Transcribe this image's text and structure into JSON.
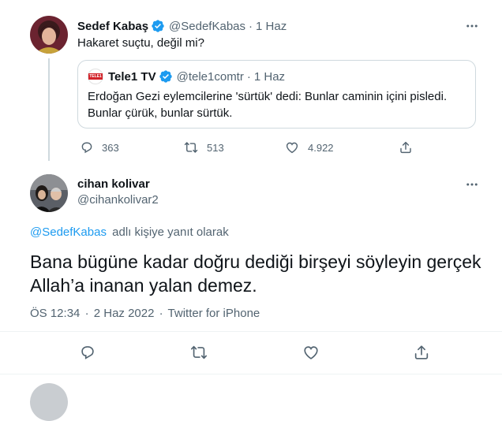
{
  "parent_tweet": {
    "author_name": "Sedef Kabaş",
    "author_handle": "@SedefKabas",
    "separator": "·",
    "time": "1 Haz",
    "text": "Hakaret suçtu, değil mi?",
    "quoted": {
      "logo_text": "TELE1",
      "author_name": "Tele1 TV",
      "author_handle": "@tele1comtr",
      "separator": "·",
      "time": "1 Haz",
      "text_line1": "Erdoğan Gezi eylemcilerine 'sürtük' dedi: Bunlar caminin içini pisledi.",
      "text_line2": "Bunlar çürük, bunlar sürtük."
    },
    "actions": {
      "replies": "363",
      "retweets": "513",
      "likes": "4.922"
    }
  },
  "main_tweet": {
    "author_name": "cihan kolivar",
    "author_handle": "@cihankolivar2",
    "reply_to_user": "@SedefKabas",
    "reply_to_suffix": "adlı kişiye yanıt olarak",
    "text_line1": "Bana bügüne kadar doğru dediği birşeyi söyleyin gerçek",
    "text_line2": "Allah’a inanan yalan demez.",
    "time": "ÖS 12:34",
    "separator1": "·",
    "date": "2 Haz 2022",
    "separator2": "·",
    "source": "Twitter for iPhone"
  },
  "colors": {
    "accent": "#1d9bf0",
    "muted": "#536471",
    "text": "#0f1419",
    "border": "#cfd9de",
    "verified": "#1d9bf0"
  },
  "icons": [
    "more-icon",
    "verified-icon",
    "reply-icon",
    "retweet-icon",
    "like-icon",
    "share-icon"
  ]
}
